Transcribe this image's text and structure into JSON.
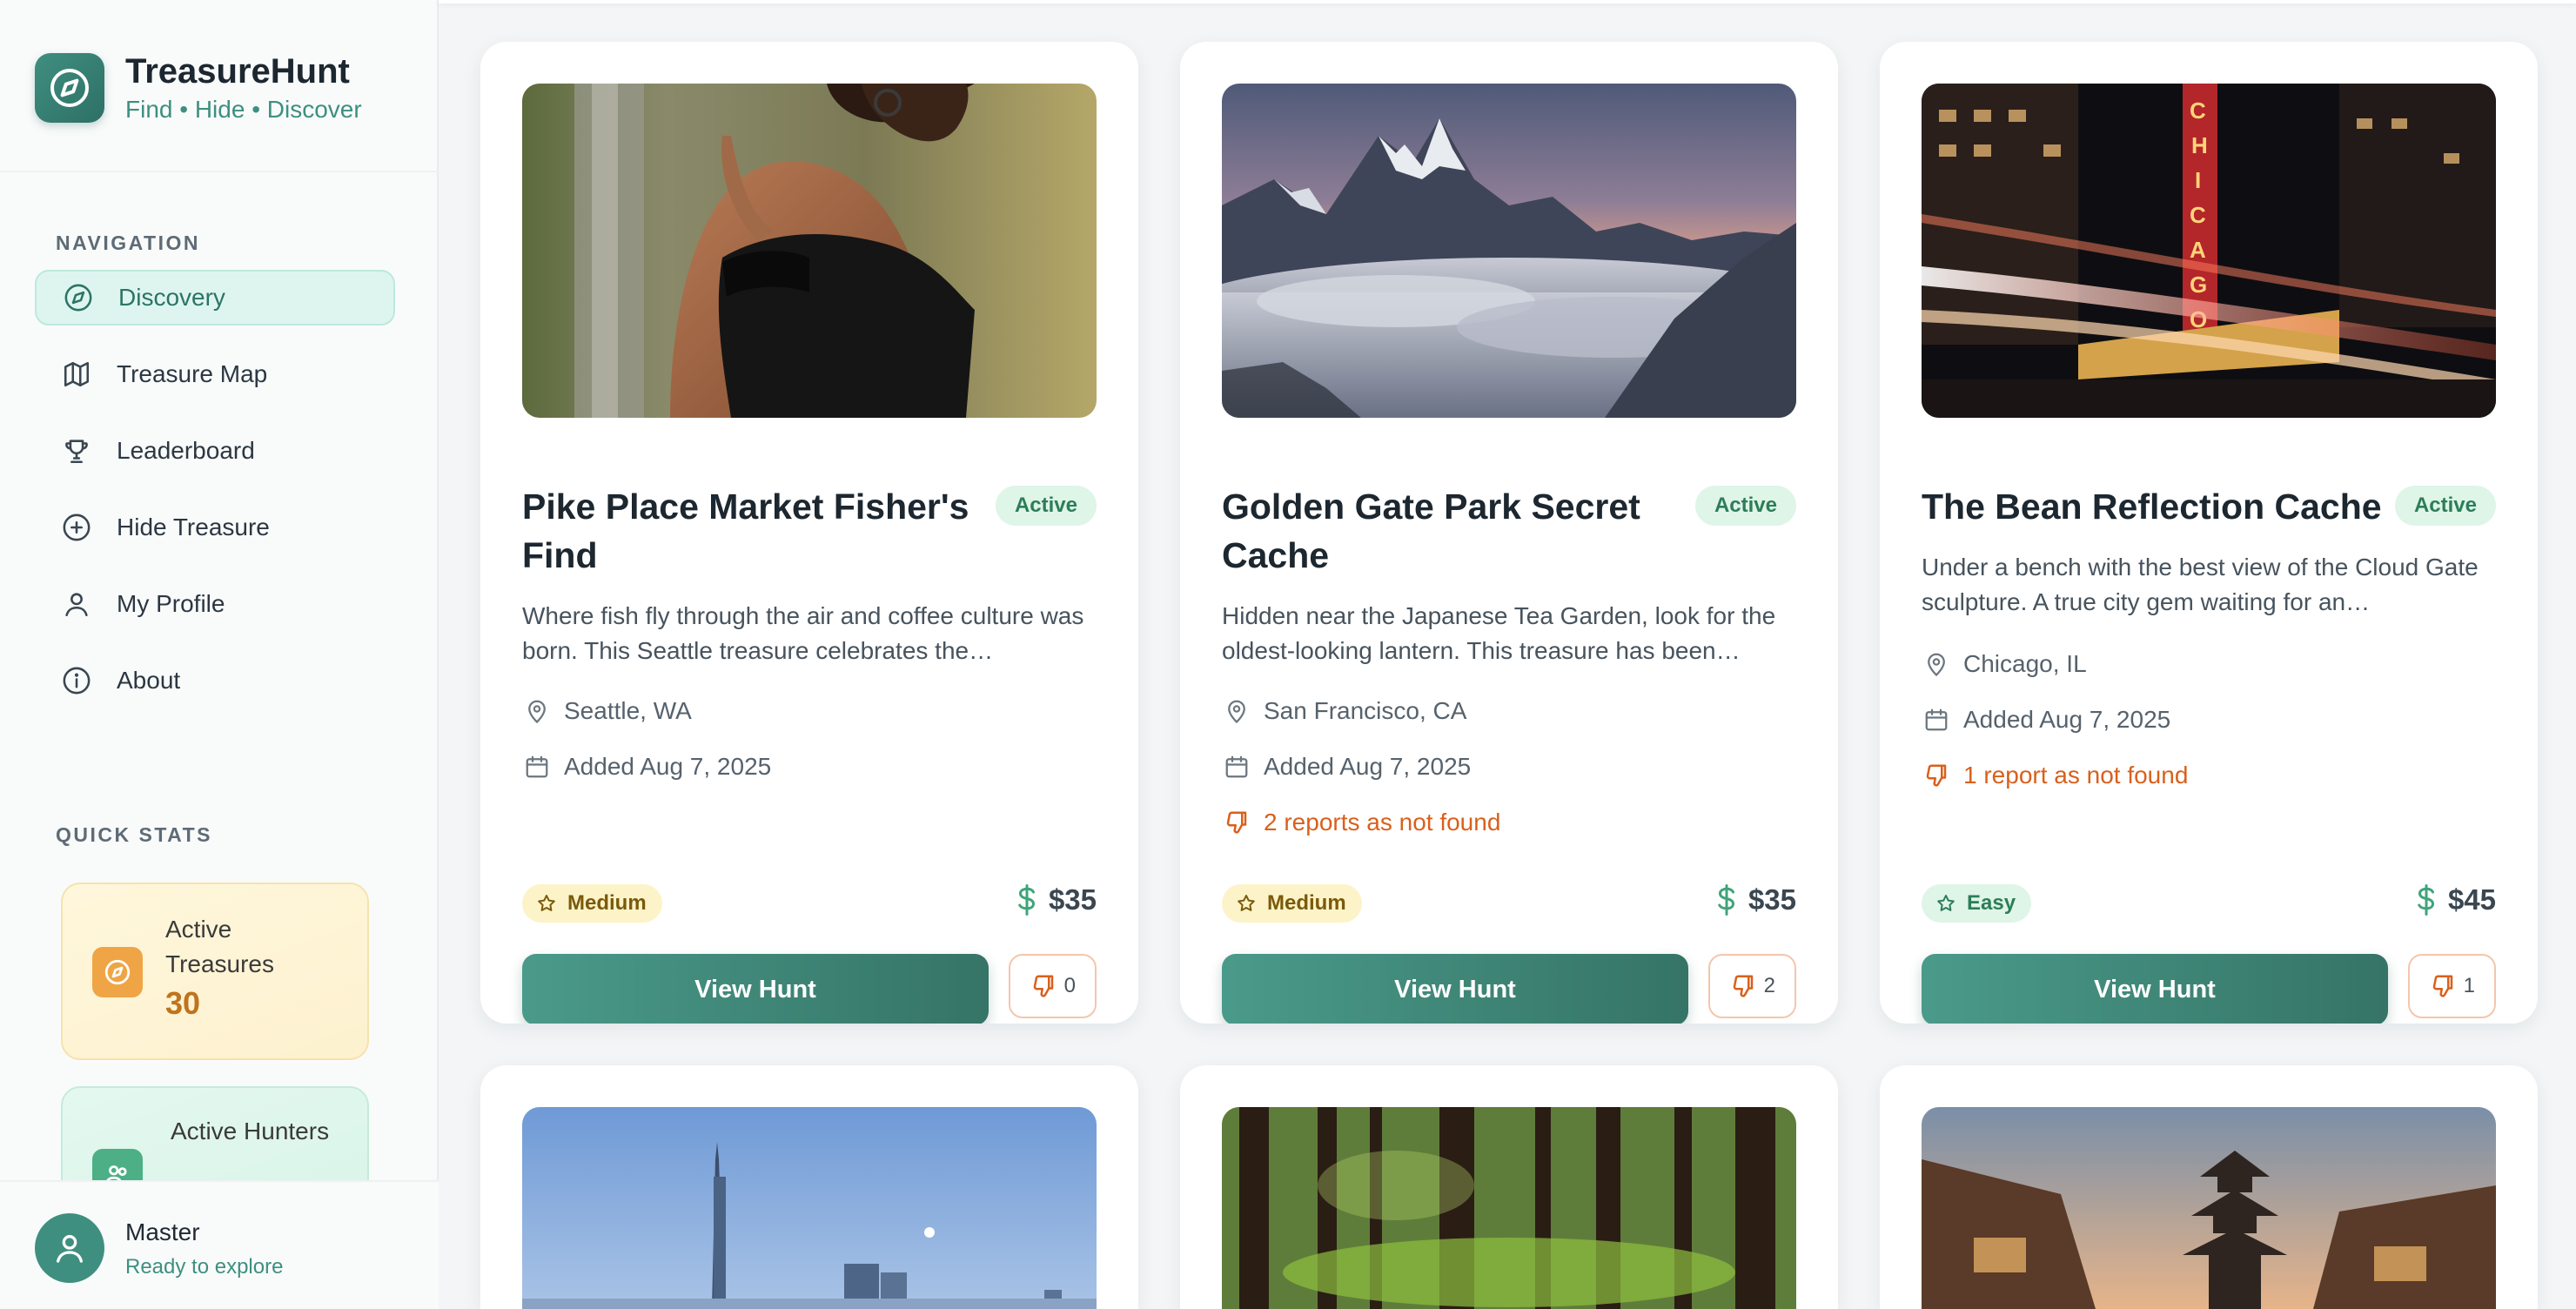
{
  "app": {
    "title": "TreasureHunt",
    "tagline": "Find • Hide • Discover",
    "logo_icon": "compass-icon"
  },
  "sidebar": {
    "nav_label": "NAVIGATION",
    "items": [
      {
        "label": "Discovery",
        "icon": "compass-icon",
        "active": true
      },
      {
        "label": "Treasure Map",
        "icon": "map-icon",
        "active": false
      },
      {
        "label": "Leaderboard",
        "icon": "trophy-icon",
        "active": false
      },
      {
        "label": "Hide Treasure",
        "icon": "plus-circle-icon",
        "active": false
      },
      {
        "label": "My Profile",
        "icon": "user-icon",
        "active": false
      },
      {
        "label": "About",
        "icon": "info-icon",
        "active": false
      }
    ],
    "stats_label": "QUICK STATS",
    "stats": [
      {
        "label": "Active Treasures",
        "value": "30",
        "icon": "compass-icon",
        "color": "#efa545"
      },
      {
        "label": "Active Hunters",
        "value": "",
        "icon": "users-icon",
        "color": "#4caf86"
      }
    ],
    "user": {
      "name": "Master",
      "status": "Ready to explore",
      "icon": "user-icon"
    }
  },
  "cards": [
    {
      "title": "Pike Place Market Fisher's Find",
      "status": "Active",
      "description": "Where fish fly through the air and coffee culture was born. This Seattle treasure celebrates the…",
      "location": "Seattle, WA",
      "added": "Added Aug 7, 2025",
      "reports": "",
      "difficulty": "Medium",
      "price": "$35",
      "view_label": "View Hunt",
      "report_count": "0",
      "image": "woman-portrait-photo"
    },
    {
      "title": "Golden Gate Park Secret Cache",
      "status": "Active",
      "description": "Hidden near the Japanese Tea Garden, look for the oldest-looking lantern. This treasure has been…",
      "location": "San Francisco, CA",
      "added": "Added Aug 7, 2025",
      "reports": "2 reports as not found",
      "difficulty": "Medium",
      "price": "$35",
      "view_label": "View Hunt",
      "report_count": "2",
      "image": "mountain-clouds-photo"
    },
    {
      "title": "The Bean Reflection Cache",
      "status": "Active",
      "description": "Under a bench with the best view of the Cloud Gate sculpture. A true city gem waiting for an…",
      "location": "Chicago, IL",
      "added": "Added Aug 7, 2025",
      "reports": "1 report as not found",
      "difficulty": "Easy",
      "price": "$45",
      "view_label": "View Hunt",
      "report_count": "1",
      "image": "chicago-theater-photo"
    },
    {
      "image": "city-skyline-photo"
    },
    {
      "image": "forest-photo"
    },
    {
      "image": "pagoda-street-photo"
    }
  ],
  "colors": {
    "accent": "#3f8f80",
    "active_badge_bg": "#def5e8",
    "warning": "#d9601c",
    "medium_bg": "#fdf3c8"
  }
}
